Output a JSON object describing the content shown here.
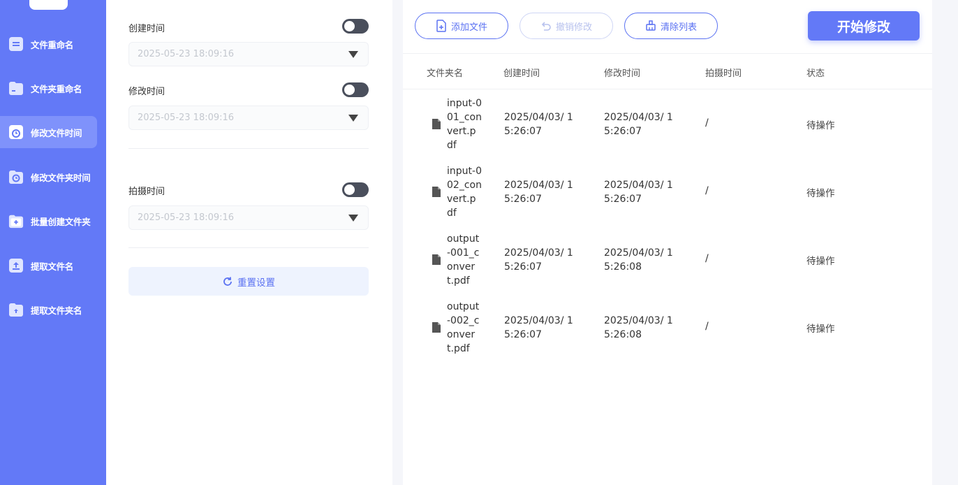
{
  "sidebar": {
    "items": [
      {
        "label": "文件重命名",
        "icon": "document-icon"
      },
      {
        "label": "文件夹重命名",
        "icon": "folder-icon"
      },
      {
        "label": "修改文件时间",
        "icon": "clock-document-icon",
        "active": true
      },
      {
        "label": "修改文件夹时间",
        "icon": "clock-folder-icon"
      },
      {
        "label": "批量创建文件夹",
        "icon": "add-folder-icon"
      },
      {
        "label": "提取文件名",
        "icon": "upload-document-icon"
      },
      {
        "label": "提取文件夹名",
        "icon": "upload-folder-icon"
      }
    ]
  },
  "settings": {
    "created": {
      "label": "创建时间",
      "value": "2025-05-23 18:09:16"
    },
    "modified": {
      "label": "修改时间",
      "value": "2025-05-23 18:09:16"
    },
    "shot": {
      "label": "拍摄时间",
      "value": "2025-05-23 18:09:16"
    },
    "reset_label": "重置设置"
  },
  "toolbar": {
    "add_label": "添加文件",
    "undo_label": "撤销修改",
    "clear_label": "清除列表",
    "start_label": "开始修改"
  },
  "table": {
    "headers": [
      "文件夹名",
      "创建时间",
      "修改时间",
      "拍摄时间",
      "状态"
    ],
    "rows": [
      {
        "name": "input-001_convert.pdf",
        "created": "2025/04/03/ 15:26:07",
        "modified": "2025/04/03/ 15:26:07",
        "shot": "/",
        "status": "待操作"
      },
      {
        "name": "input-002_convert.pdf",
        "created": "2025/04/03/ 15:26:07",
        "modified": "2025/04/03/ 15:26:07",
        "shot": "/",
        "status": "待操作"
      },
      {
        "name": "output-001_convert.pdf",
        "created": "2025/04/03/ 15:26:07",
        "modified": "2025/04/03/ 15:26:08",
        "shot": "/",
        "status": "待操作"
      },
      {
        "name": "output-002_convert.pdf",
        "created": "2025/04/03/ 15:26:07",
        "modified": "2025/04/03/ 15:26:08",
        "shot": "/",
        "status": "待操作"
      }
    ]
  },
  "colors": {
    "accent": "#6379f7",
    "sidebar_active": "#7f92fb",
    "button_outline": "#5b72f2"
  }
}
